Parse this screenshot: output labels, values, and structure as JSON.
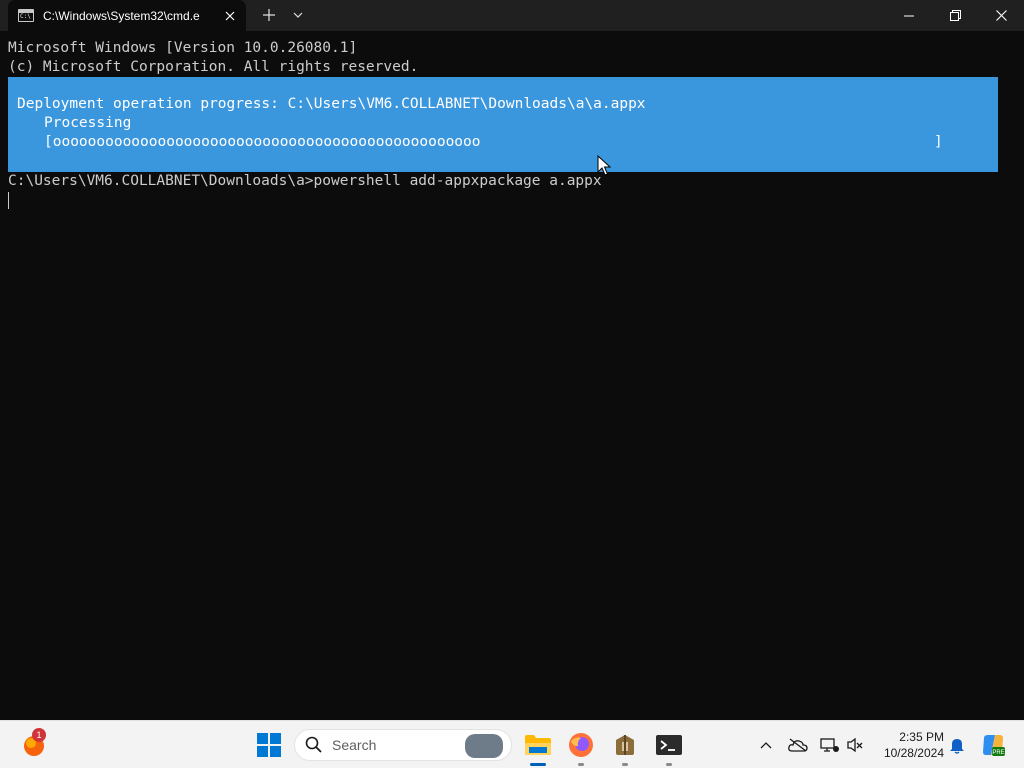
{
  "window": {
    "tab_title": "C:\\Windows\\System32\\cmd.e"
  },
  "terminal": {
    "lines": [
      "Microsoft Windows [Version 10.0.26080.1]",
      "(c) Microsoft Corporation. All rights reserved."
    ],
    "progress": {
      "title": "Deployment operation progress: C:\\Users\\VM6.COLLABNET\\Downloads\\a\\a.appx",
      "status": "Processing",
      "bar_open": "[ooooooooooooooooooooooooooooooooooooooooooooooooo",
      "bar_close": "]",
      "percent": 54
    },
    "command_line": "C:\\Users\\VM6.COLLABNET\\Downloads\\a>powershell add-appxpackage a.appx"
  },
  "taskbar": {
    "weather_badge": "1",
    "search_label": "Search",
    "apps": [
      "file-explorer",
      "firefox",
      "archive-app",
      "terminal"
    ],
    "clock_time": "2:35 PM",
    "clock_date": "10/28/2024"
  },
  "colors": {
    "terminal_bg": "#0c0c0c",
    "progress_bg": "#3a96dd",
    "titlebar_bg": "#202020",
    "taskbar_bg": "#f3f3f3"
  }
}
